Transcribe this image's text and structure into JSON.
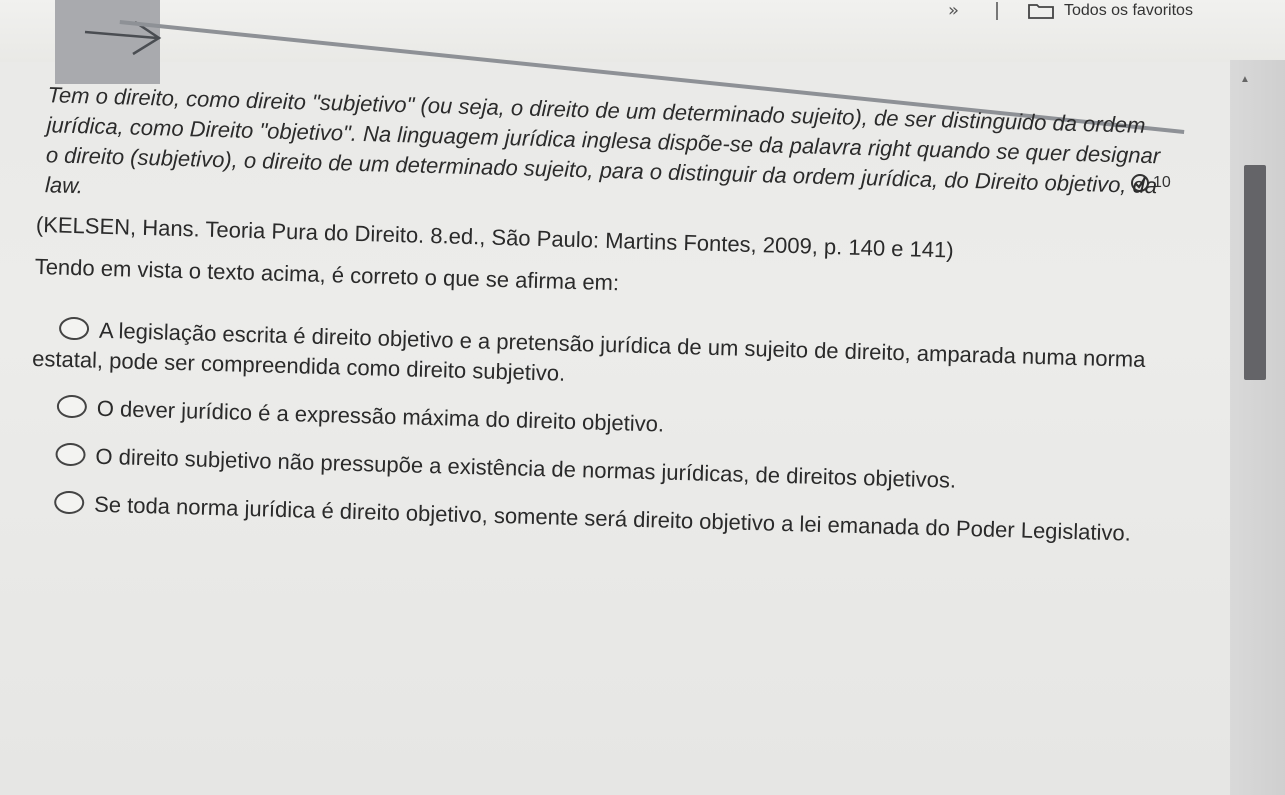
{
  "toolbar": {
    "chevron": "»",
    "bookmarks_label": "Todos os favoritos"
  },
  "question": {
    "points": "10",
    "text_italic": "Tem o direito, como direito \"subjetivo\" (ou seja, o direito de um determinado sujeito), de ser distinguido da ordem jurídica, como Direito \"objetivo\". Na linguagem jurídica inglesa dispõe-se da palavra right quando se quer designar o direito (subjetivo), o direito de um determinado sujeito, para o distinguir da ordem jurídica, do Direito objetivo, da law.",
    "citation": "(KELSEN, Hans. Teoria Pura do Direito. 8.ed., São Paulo: Martins Fontes, 2009, p. 140 e 141)",
    "prompt": "Tendo em vista o texto acima, é correto o que se afirma em:",
    "options": [
      {
        "label": "A legislação escrita é direito objetivo e a pretensão jurídica de um sujeito de direito, amparada numa norma estatal, pode ser compreendida como direito subjetivo."
      },
      {
        "label": "O dever jurídico é a expressão máxima do direito objetivo."
      },
      {
        "label": "O direito subjetivo não pressupõe a existência de normas jurídicas, de direitos objetivos."
      },
      {
        "label": "Se toda norma jurídica é direito objetivo, somente será direito objetivo a lei emanada do Poder Legislativo."
      }
    ]
  },
  "colors": {
    "back_block": "#a9aaae",
    "scroll_thumb": "#646468",
    "text": "#2a2a2a"
  }
}
